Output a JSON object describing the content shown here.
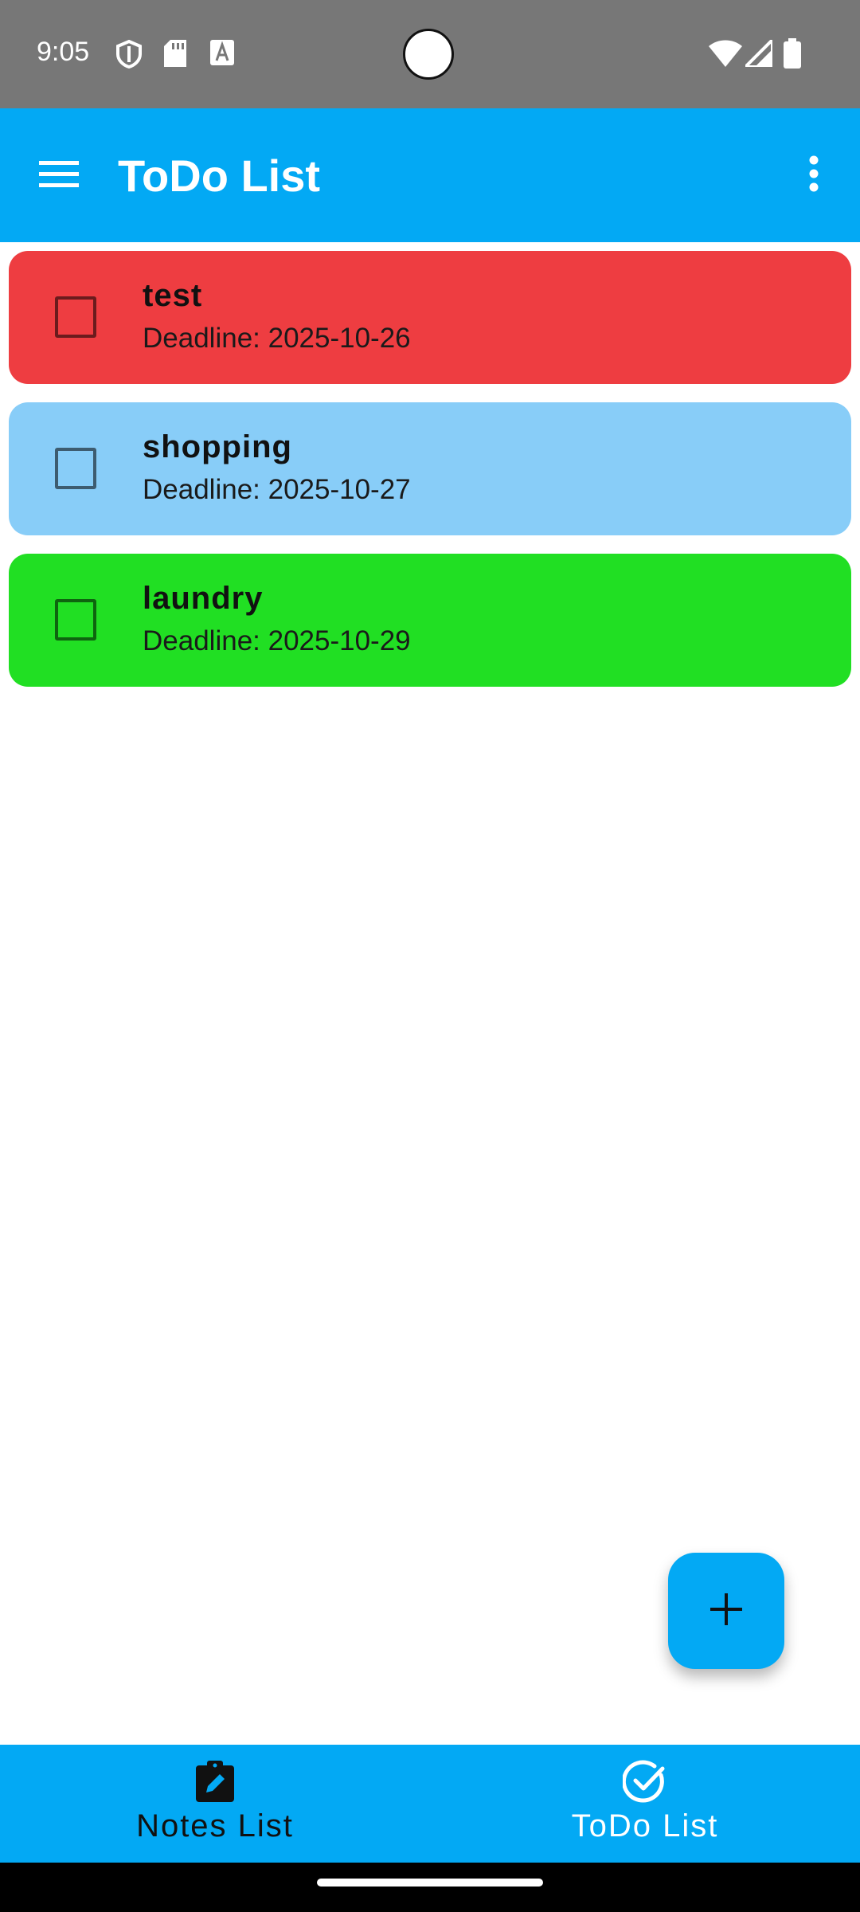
{
  "status_bar": {
    "time": "9:05",
    "left_icons": [
      "shield-icon",
      "sd-card-icon",
      "font-a-icon"
    ],
    "right_icons": [
      "wifi-icon",
      "signal-icon",
      "battery-icon"
    ],
    "background": "#777777"
  },
  "app_bar": {
    "title": "ToDo List",
    "menu_icon": "hamburger-menu-icon",
    "overflow_icon": "more-vert-icon",
    "color": "#03a9f4"
  },
  "todos": [
    {
      "title": "test",
      "deadline": "Deadline: 2025-10-26",
      "color": "#ee3d41",
      "checked": false
    },
    {
      "title": "shopping",
      "deadline": "Deadline: 2025-10-27",
      "color": "#88cdf8",
      "checked": false
    },
    {
      "title": "laundry",
      "deadline": "Deadline: 2025-10-29",
      "color": "#21df23",
      "checked": false
    }
  ],
  "fab": {
    "icon": "plus-icon"
  },
  "bottom_nav": {
    "items": [
      {
        "label": "Notes List",
        "icon": "clipboard-edit-icon",
        "active": false
      },
      {
        "label": "ToDo List",
        "icon": "check-circle-icon",
        "active": true
      }
    ]
  }
}
